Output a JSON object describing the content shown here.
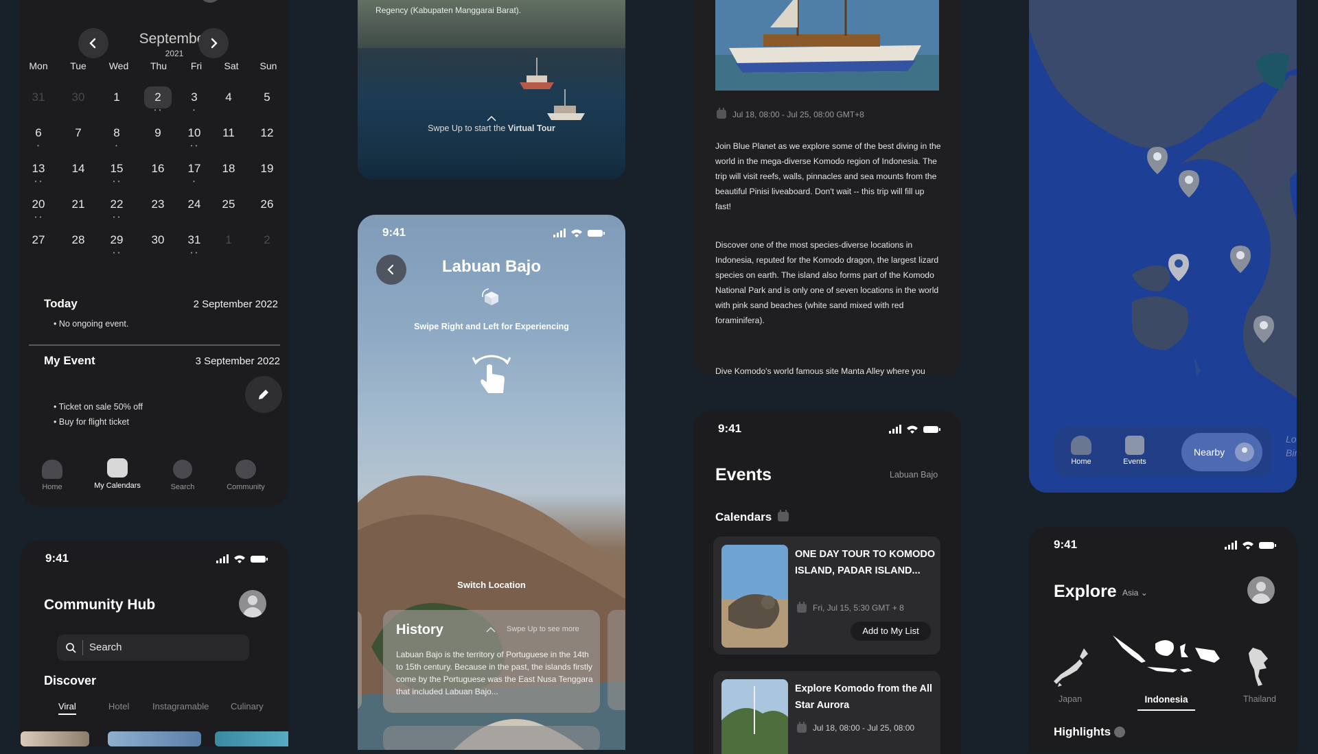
{
  "calendar": {
    "month": "September",
    "year": "2021",
    "weekdays": [
      "Mon",
      "Tue",
      "Wed",
      "Thu",
      "Fri",
      "Sat",
      "Sun"
    ],
    "weeks": [
      [
        "31",
        "30",
        "1",
        "2",
        "3",
        "4",
        "5"
      ],
      [
        "6",
        "7",
        "8",
        "9",
        "10",
        "11",
        "12"
      ],
      [
        "13",
        "14",
        "15",
        "16",
        "17",
        "18",
        "19"
      ],
      [
        "20",
        "21",
        "22",
        "23",
        "24",
        "25",
        "26"
      ],
      [
        "27",
        "28",
        "29",
        "30",
        "31",
        "1",
        "2"
      ]
    ],
    "today_label": "Today",
    "today_date": "2 September 2022",
    "today_event": "No ongoing event.",
    "myevent_label": "My Event",
    "myevent_date": "3 September 2022",
    "myevent_items": [
      "Ticket on sale 50% off",
      "Buy for flight ticket"
    ],
    "nav": [
      "Home",
      "My Calendars",
      "Search",
      "Community"
    ]
  },
  "community": {
    "time": "9:41",
    "title": "Community Hub",
    "search_placeholder": "Search",
    "discover": "Discover",
    "tabs": [
      "Viral",
      "Hotel",
      "Instagramable",
      "Culinary"
    ]
  },
  "tour_top": {
    "caption": "Regency (Kabupaten Manggarai Barat).",
    "swipe_prefix": "Swpe Up to start the ",
    "swipe_bold": "Virtual Tour"
  },
  "tour": {
    "time": "9:41",
    "title": "Labuan Bajo",
    "hint": "Swipe Right and Left for Experiencing",
    "switch_location": "Switch Location",
    "history_title": "History",
    "history_hint": "Swpe Up to see more",
    "history_text": "Labuan Bajo is the territory of Portuguese in the 14th to 15th century. Because in the past, the islands firstly come by the Portuguese was the East Nusa Tenggara that included Labuan Bajo..."
  },
  "detail": {
    "date": "Jul 18, 08:00 - Jul 25, 08:00 GMT+8",
    "para1": "Join Blue Planet as we explore some of the best diving in the world in the mega-diverse Komodo region of Indonesia. The trip will visit reefs, walls, pinnacles and sea mounts from the beautiful Pinisi liveaboard. Don't wait -- this trip will fill up fast!",
    "para2": "Discover one of the most species-diverse locations in Indonesia, reputed for the Komodo dragon, the largest lizard species on earth. The island also forms part of the Komodo National Park and is only one of seven locations in the world with pink sand beaches (white sand mixed with red foraminifera).",
    "para3": "Dive Komodo's world famous site Manta Alley where you"
  },
  "events": {
    "time": "9:41",
    "title": "Events",
    "location": "Labuan Bajo",
    "calendars_label": "Calendars",
    "items": [
      {
        "title": "ONE DAY TOUR TO KOMODO ISLAND, PADAR ISLAND...",
        "date": "Fri, Jul 15, 5:30 GMT + 8",
        "button": "Add to My List"
      },
      {
        "title": "Explore Komodo from the All Star Aurora",
        "date": "Jul 18, 08:00 - Jul 25, 08:00"
      }
    ]
  },
  "map": {
    "nav": [
      "Home",
      "Events"
    ],
    "nearby": "Nearby",
    "edge_label": "Lo\nBina"
  },
  "explore": {
    "time": "9:41",
    "title": "Explore",
    "region": "Asia",
    "countries": [
      "Japan",
      "Indonesia",
      "Thailand"
    ],
    "highlights": "Highlights"
  }
}
